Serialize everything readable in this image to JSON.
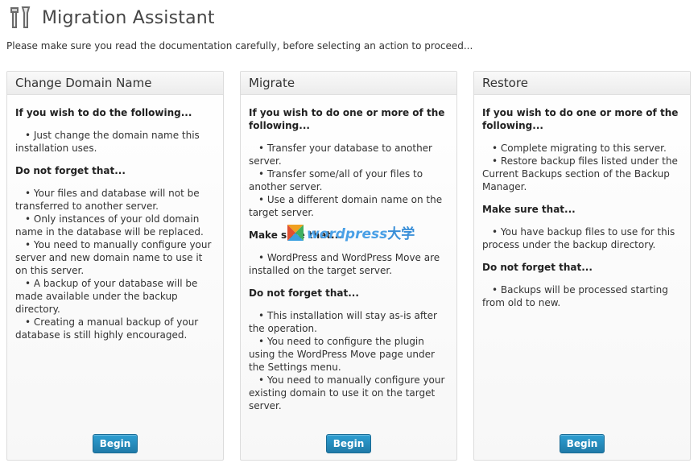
{
  "header": {
    "title": "Migration Assistant",
    "icon": "tools-icon"
  },
  "intro": "Please make sure you read the documentation carefully, before selecting an action to proceed...",
  "panels": [
    {
      "title": "Change Domain Name",
      "sections": [
        {
          "heading": "If you wish to do the following...",
          "items": [
            "• Just change the domain name this installation uses."
          ]
        },
        {
          "heading": "Do not forget that...",
          "items": [
            "• Your files and database will not be transferred to another server.",
            "• Only instances of your old domain name in the database will be replaced.",
            "• You need to manually configure your server and new domain name to use it on this server.",
            "• A backup of your database will be made available under the backup directory.",
            "• Creating a manual backup of your database is still highly encouraged."
          ]
        }
      ],
      "button": "Begin"
    },
    {
      "title": "Migrate",
      "sections": [
        {
          "heading": "If you wish to do one or more of the following...",
          "items": [
            "• Transfer your database to another server.",
            "• Transfer some/all of your files to another server.",
            "• Use a different domain name on the target server."
          ]
        },
        {
          "heading": "Make sure that...",
          "items": [
            "• WordPress and WordPress Move are installed on the target server."
          ]
        },
        {
          "heading": "Do not forget that...",
          "items": [
            "• This installation will stay as-is after the operation.",
            "• You need to configure the plugin using the WordPress Move page under the Settings menu.",
            "• You need to manually configure your existing domain to use it on the target server."
          ]
        }
      ],
      "button": "Begin"
    },
    {
      "title": "Restore",
      "sections": [
        {
          "heading": "If you wish to do one or more of the following...",
          "items": [
            "• Complete migrating to this server.",
            "• Restore backup files listed under the Current Backups section of the Backup Manager."
          ]
        },
        {
          "heading": "Make sure that...",
          "items": [
            "• You have backup files to use for this process under the backup directory."
          ]
        },
        {
          "heading": "Do not forget that...",
          "items": [
            "• Backups will be processed starting from old to new."
          ]
        }
      ],
      "button": "Begin"
    }
  ],
  "watermark": {
    "text": "wordpress",
    "text_cn": "大学"
  },
  "colors": {
    "button": "#2585b8",
    "text": "#333333",
    "border": "#dcdcdc"
  }
}
